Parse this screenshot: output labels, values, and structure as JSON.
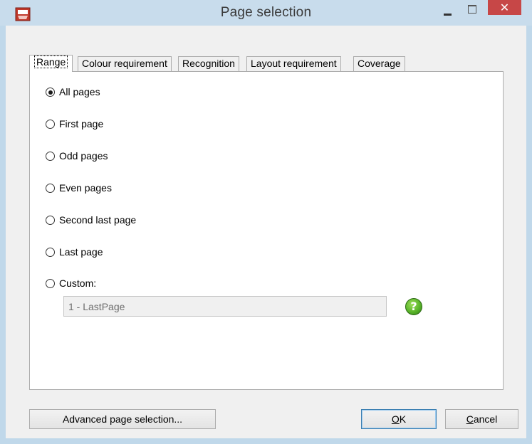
{
  "window": {
    "title": "Page selection",
    "close_glyph": "✕"
  },
  "tabs": [
    {
      "label": "Range",
      "active": true
    },
    {
      "label": "Colour requirement",
      "active": false
    },
    {
      "label": "Recognition",
      "active": false
    },
    {
      "label": "Layout requirement",
      "active": false
    },
    {
      "label": "Coverage",
      "active": false
    }
  ],
  "range": {
    "options": [
      {
        "label": "All pages",
        "checked": true
      },
      {
        "label": "First page",
        "checked": false
      },
      {
        "label": "Odd pages",
        "checked": false
      },
      {
        "label": "Even pages",
        "checked": false
      },
      {
        "label": "Second last page",
        "checked": false
      },
      {
        "label": "Last page",
        "checked": false
      },
      {
        "label": "Custom:",
        "checked": false
      }
    ],
    "custom_value": "1 - LastPage",
    "help_glyph": "?"
  },
  "buttons": {
    "advanced": "Advanced page selection...",
    "ok_mnemonic": "O",
    "ok_rest": "K",
    "cancel_mnemonic": "C",
    "cancel_rest": "ancel"
  },
  "colors": {
    "close_button": "#c74747",
    "help_icon": "#5ab52a",
    "titlebar": "#c8dcec"
  }
}
